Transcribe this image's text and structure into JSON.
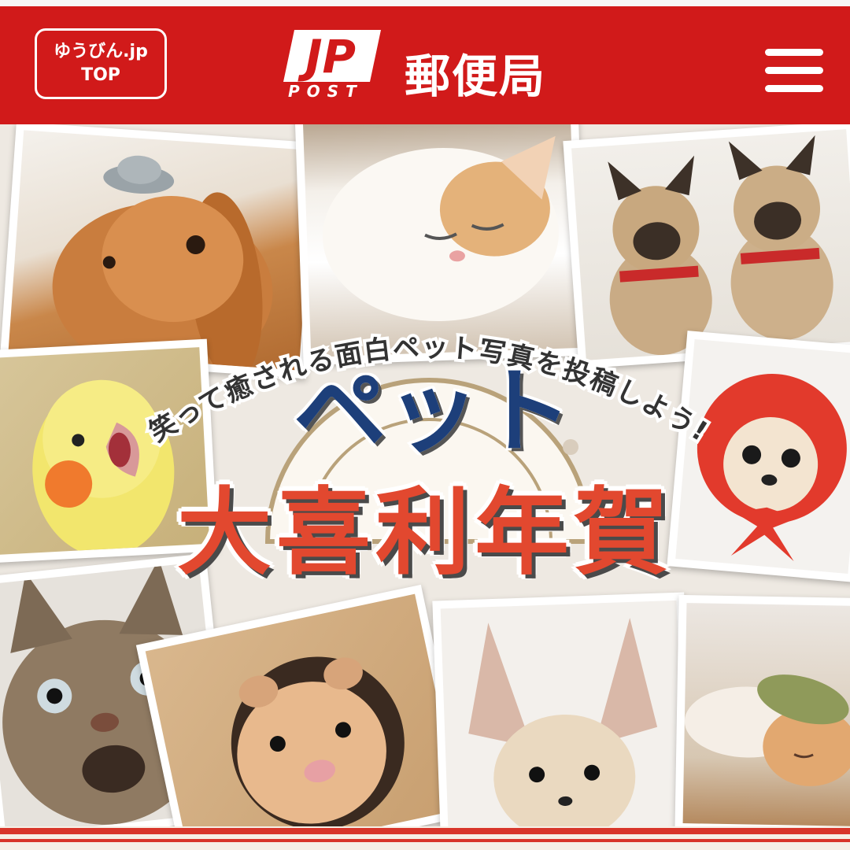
{
  "header": {
    "top_button_line1": "ゆうびん.jp",
    "top_button_line2": "TOP",
    "logo_mark": "JP",
    "logo_post": "POST",
    "logo_name": "郵便局",
    "menu_icon": "hamburger-menu-icon",
    "brand_color": "#d11a1a"
  },
  "hero": {
    "subtitle": "笑って癒される面白ペット写真を投稿しよう!",
    "title_top": "ペット",
    "title_main": "大喜利年賀",
    "title_top_color": "#1d3f7a",
    "title_main_color": "#e2482f",
    "photos": [
      {
        "subject": "rabbit-with-hat"
      },
      {
        "subject": "sleeping-cat"
      },
      {
        "subject": "two-french-bulldogs"
      },
      {
        "subject": "cockatiel"
      },
      {
        "subject": "chihuahua-in-red-hood"
      },
      {
        "subject": "surprised-tabby-cat"
      },
      {
        "subject": "hamster-in-hole"
      },
      {
        "subject": "fennec-fox"
      },
      {
        "subject": "cat-with-leaf"
      }
    ]
  }
}
